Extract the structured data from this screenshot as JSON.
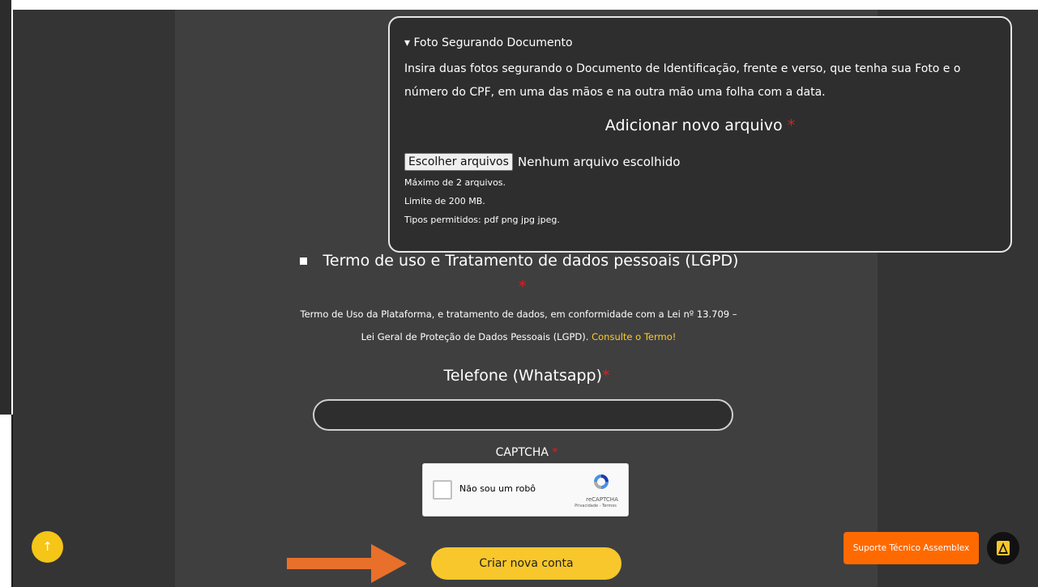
{
  "upload_section": {
    "summary": "▾ Foto Segurando Documento",
    "description": "Insira duas fotos segurando o Documento de Identificação, frente e verso, que tenha sua Foto e o número do CPF, em uma das mãos e na outra mão uma folha com a data.",
    "add_file_label": "Adicionar novo arquivo",
    "required_mark": "*",
    "choose_button": "Escolher arquivos",
    "file_status": "Nenhum arquivo escolhido",
    "max_files": "Máximo de 2 arquivos.",
    "size_limit": "Limite de 200 MB.",
    "allowed_types": "Tipos permitidos: pdf png jpg jpeg."
  },
  "terms": {
    "label": "Termo de uso e Tratamento de dados pessoais (LGPD)",
    "required_mark": "*",
    "text": "Termo de Uso da Plataforma, e tratamento de dados, em conformidade com a Lei nº 13.709 – Lei Geral de Proteção de Dados Pessoais (LGPD).",
    "link": "Consulte o Termo!"
  },
  "phone": {
    "label": "Telefone (Whatsapp)",
    "required_mark": "*",
    "value": ""
  },
  "captcha": {
    "label": "CAPTCHA",
    "required_mark": "*",
    "checkbox_label": "Não sou um robô",
    "brand": "reCAPTCHA",
    "links": "Privacidade - Termos"
  },
  "actions": {
    "scroll_top_icon": "↑",
    "create_account": "Criar nova conta",
    "support": "Suporte Técnico Assemblex"
  },
  "colors": {
    "accent_yellow": "#f8c72b",
    "support_orange": "#ff6a00",
    "required_red": "#e11d1d",
    "arrow_orange": "#e8702a"
  }
}
